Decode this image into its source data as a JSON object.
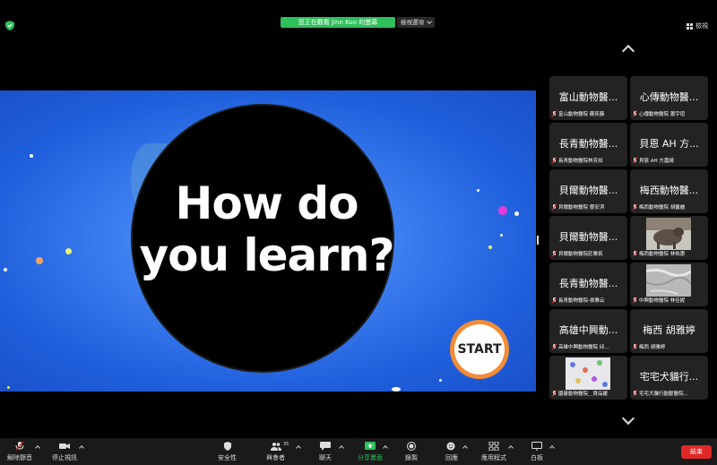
{
  "share_banner": "您正在觀看 Jinn Kuo 的螢幕",
  "view_options": "檢視選項",
  "view_button": "檢視",
  "slide": {
    "line1": "How do",
    "line2": "you learn?",
    "start_label": "START"
  },
  "participants": [
    {
      "display": "富山動物醫...",
      "name": "富山動物醫院 蘇奕靜"
    },
    {
      "display": "心傳動物醫...",
      "name": "心傳動物醫院 蕭宇瑄"
    },
    {
      "display": "長青動物醫...",
      "name": "長青動物醫院林芳如"
    },
    {
      "display": "貝恩 AH 方...",
      "name": "貝恩 AH 方嘉綺"
    },
    {
      "display": "貝爾動物醫...",
      "name": "貝爾動物醫院 鄧安淇"
    },
    {
      "display": "梅西動物醫...",
      "name": "梅西動物醫院 胡馨麗"
    },
    {
      "display": "貝爾動物醫...",
      "name": "貝爾動物醫院莊雅筑"
    },
    {
      "display": "",
      "name": "梅西動物醫院 林祐惠"
    },
    {
      "display": "長青動物醫...",
      "name": "長青動物醫院-侯雅云"
    },
    {
      "display": "",
      "name": "中興動物醫院 林佳妮"
    },
    {
      "display": "高雄中興動...",
      "name": "高雄中興動物醫院 邱..."
    },
    {
      "display": "梅西 胡雅婷",
      "name": "梅西 胡雅婷"
    },
    {
      "display": "",
      "name": "園碁動物醫院＿齊品媛"
    },
    {
      "display": "宅宅犬貓行...",
      "name": "宅宅犬貓行動獸醫院..."
    }
  ],
  "toolbar": {
    "unmute": "解除靜音",
    "stop_video": "停止視訊",
    "security": "安全性",
    "participants": "與會者",
    "participants_count": "35",
    "chat": "聊天",
    "share_screen": "分享畫面",
    "record": "錄製",
    "reactions": "回應",
    "apps": "應用程式",
    "whiteboard": "白板",
    "end": "結束"
  },
  "colors": {
    "banner_green": "#2fbf5b",
    "end_red": "#e02828",
    "start_orange": "#f28c36",
    "share_green": "#2fbf5b"
  }
}
